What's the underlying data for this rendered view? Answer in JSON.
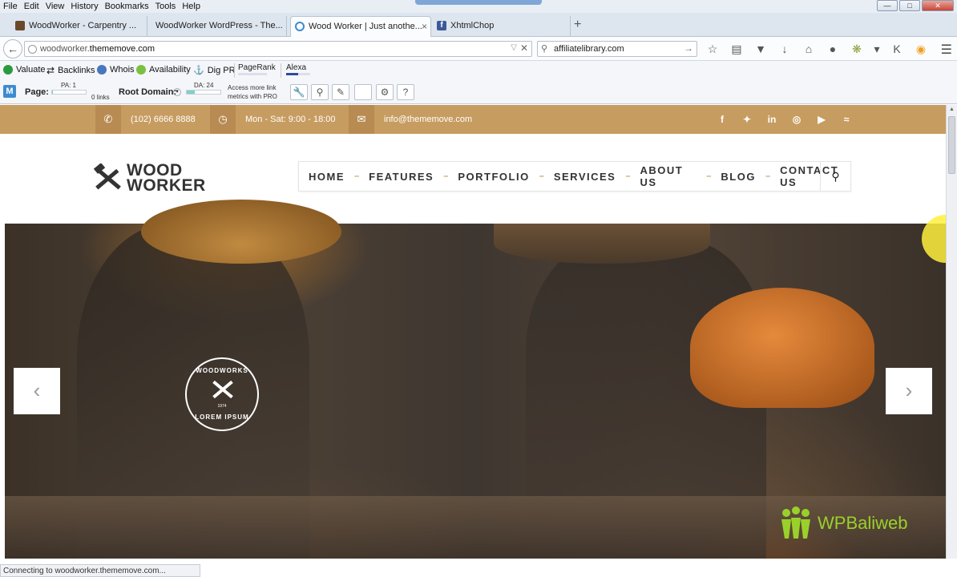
{
  "browser": {
    "menu": [
      "File",
      "Edit",
      "View",
      "History",
      "Bookmarks",
      "Tools",
      "Help"
    ],
    "tabs": [
      {
        "label": "WoodWorker - Carpentry ...",
        "color": "#6b4a2a"
      },
      {
        "label": "WoodWorker WordPress - The...",
        "color": "#dde5ef"
      },
      {
        "label": "Wood Worker | Just anothe...",
        "color": "#3d8bd0"
      },
      {
        "label": "XhtmlChop",
        "color": "#3b5998"
      }
    ],
    "url_prefix": "woodworker.",
    "url_main": "thememove.com",
    "search_value": "affiliatelibrary.com",
    "status": "Connecting to woodworker.thememove.com..."
  },
  "seo_toolbar": {
    "valuate": "Valuate",
    "backlinks": "Backlinks",
    "whois": "Whois",
    "availability": "Availability",
    "digpr": "Dig PR",
    "pagerank": "PageRank",
    "alexa": "Alexa",
    "page_label": "Page:",
    "pa": "PA: 1",
    "links": "0 links",
    "root_label": "Root Domain:",
    "da": "DA: 24",
    "access_line1": "Access more link",
    "access_line2": "metrics with PRO"
  },
  "site": {
    "phone": "(102) 6666 8888",
    "hours": "Mon - Sat: 9:00 - 18:00",
    "email": "info@thememove.com",
    "logo_line1": "WOOD",
    "logo_line2": "WORKER",
    "nav": [
      "HOME",
      "FEATURES",
      "PORTFOLIO",
      "SERVICES",
      "ABOUT US",
      "BLOG",
      "CONTACT US"
    ],
    "accent": "#c79c60",
    "badge_top": "WOODWORKS",
    "badge_year": "1974",
    "badge_bottom": "LOREM IPSUM"
  },
  "watermark": "WPBaliweb"
}
